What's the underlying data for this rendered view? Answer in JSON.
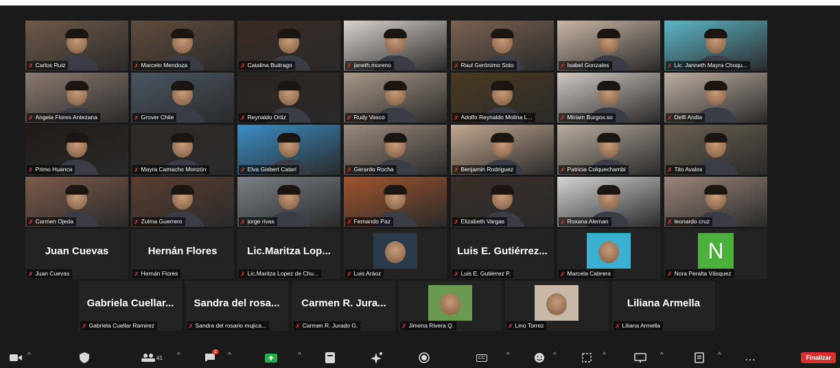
{
  "participants": [
    {
      "name": "Carlos Ruiz",
      "bg": "#6e5a48"
    },
    {
      "name": "Marcelo Mendoza",
      "bg": "#5f4c3c"
    },
    {
      "name": "Catalina Buitrago",
      "bg": "#3a2a22"
    },
    {
      "name": "janeth.moreno",
      "bg": "#d8d2cc"
    },
    {
      "name": "Raul Gerónimo Soto",
      "bg": "#7a6250"
    },
    {
      "name": "Isabel Gonzales",
      "bg": "#c9b6a4"
    },
    {
      "name": "Lic. Janneth Mayra Choqu...",
      "bg": "#5cb6c8"
    },
    {
      "name": "Angela Flores Antezana",
      "bg": "#8b7a70"
    },
    {
      "name": "Grover Chile",
      "bg": "#4a5662"
    },
    {
      "name": "Reynaldo Ortiz",
      "bg": "#2a2420"
    },
    {
      "name": "Rudy Vasco",
      "bg": "#a89888"
    },
    {
      "name": "Adolfo Reynaldo Molina L...",
      "bg": "#4a3a20"
    },
    {
      "name": "Miriam Burgos.so",
      "bg": "#cfc8c2"
    },
    {
      "name": "Delfi Andia",
      "bg": "#bcaea0"
    },
    {
      "name": "Primo Huanca",
      "bg": "#201a16"
    },
    {
      "name": "Mayra Camacho Monzón",
      "bg": "#2e2a28"
    },
    {
      "name": "Elva Gisbert Catari",
      "bg": "#3a8ec6"
    },
    {
      "name": "Gerardo Rocha",
      "bg": "#9a8a7c"
    },
    {
      "name": "Benjamin Rodriguez",
      "bg": "#c2a890"
    },
    {
      "name": "Patricia Colquechambi",
      "bg": "#b8ac9e"
    },
    {
      "name": "Tito Avalos",
      "bg": "#6a6050"
    },
    {
      "name": "Carmen Ojeda",
      "bg": "#7c5a4a"
    },
    {
      "name": "Zulma Guerrero",
      "bg": "#5a3e30"
    },
    {
      "name": "jorge rivas",
      "bg": "#7a8086"
    },
    {
      "name": "Fernando Paz",
      "bg": "#a0542c"
    },
    {
      "name": "Elizabeth Vargas",
      "bg": "#3a2e28"
    },
    {
      "name": "Roxana Aleman",
      "bg": "#d4d4d4"
    },
    {
      "name": "leonardo cruz",
      "bg": "#9a8478"
    },
    {
      "name": "Juan Cuevas",
      "display": "Juan Cuevas"
    },
    {
      "name": "Hernán Flores",
      "display": "Hernán Flores"
    },
    {
      "name": "Lic.Maritza Lopez de Chu...",
      "display": "Lic.Maritza Lop..."
    },
    {
      "name": "Luis Aráoz",
      "avatar": "#2a3a4a"
    },
    {
      "name": "Luis E. Gutiérrez P.",
      "display": "Luis E. Gutiérrez..."
    },
    {
      "name": "Marcela Cabrera",
      "avatar": "#3ab0d0"
    },
    {
      "name": "Nora Peralta Vásquez",
      "letter": "N"
    },
    {
      "name": "Gabriela Cuellar Ramirez",
      "display": "Gabriela Cuellar..."
    },
    {
      "name": "Sandra del rosario mujica...",
      "display": "Sandra del rosa..."
    },
    {
      "name": "Carmen R. Jurado G.",
      "display": "Carmen R. Jura..."
    },
    {
      "name": "Jimena Rivera Q.",
      "avatar": "#6a9a50"
    },
    {
      "name": "Lino Torrez",
      "avatar": "#c8b8a8"
    },
    {
      "name": "Liliana Armella",
      "display": "Liliana Armella"
    }
  ],
  "toolbar": {
    "participant_count": "41",
    "chat_badge": "2",
    "cc_label": "CC",
    "more_label": "...",
    "end_label": "Finalizar"
  },
  "icons": [
    "video-icon",
    "security-icon",
    "participants-icon",
    "chat-icon",
    "share-screen-icon",
    "apps-icon",
    "ai-companion-icon",
    "record-icon",
    "captions-icon",
    "reactions-icon",
    "breakout-icon",
    "whiteboard-icon",
    "notes-icon",
    "more-icon"
  ]
}
